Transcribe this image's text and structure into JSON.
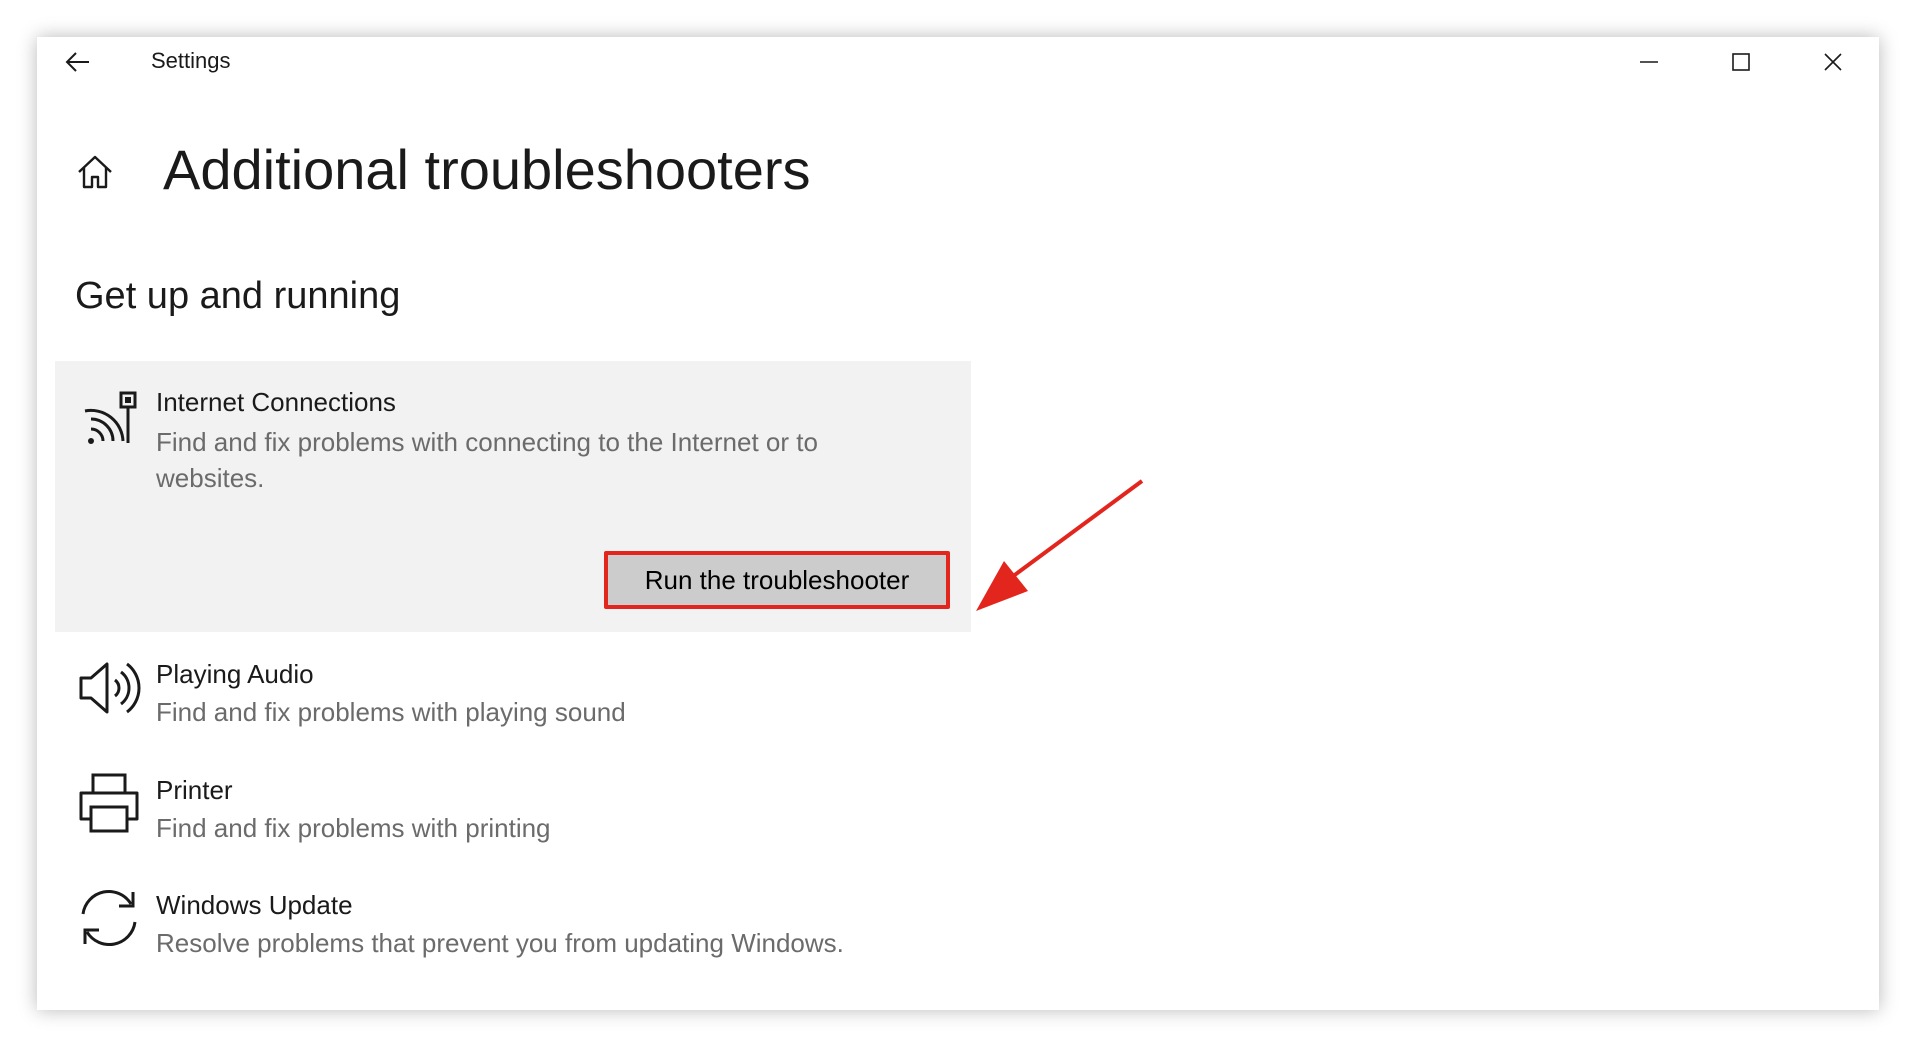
{
  "window": {
    "app_title": "Settings"
  },
  "page": {
    "title": "Additional troubleshooters",
    "section_title": "Get up and running"
  },
  "items": [
    {
      "title": "Internet Connections",
      "description": "Find and fix problems with connecting to the Internet or to websites.",
      "icon": "wifi-network-icon",
      "expanded": true,
      "button_label": "Run the troubleshooter"
    },
    {
      "title": "Playing Audio",
      "description": "Find and fix problems with playing sound",
      "icon": "speaker-icon"
    },
    {
      "title": "Printer",
      "description": "Find and fix problems with printing",
      "icon": "printer-icon"
    },
    {
      "title": "Windows Update",
      "description": "Resolve problems that prevent you from updating Windows.",
      "icon": "sync-icon"
    }
  ],
  "colors": {
    "highlight": "#e3261d",
    "card_bg": "#f2f2f2",
    "button_bg": "#cccccc",
    "secondary_text": "#6b6b6b"
  }
}
